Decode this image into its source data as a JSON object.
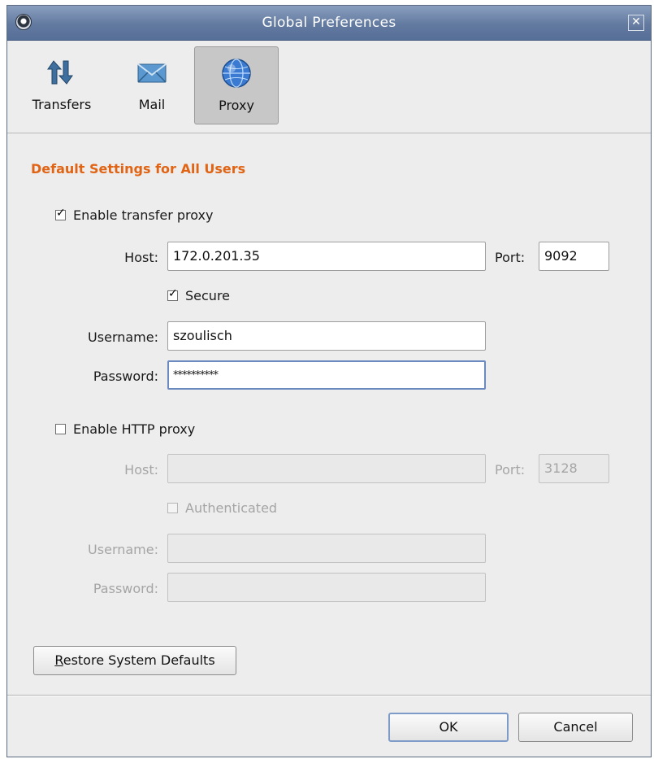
{
  "window": {
    "title": "Global Preferences",
    "close_glyph": "✕"
  },
  "toolbar": {
    "items": [
      {
        "label": "Transfers",
        "icon": "transfers-icon"
      },
      {
        "label": "Mail",
        "icon": "mail-icon"
      },
      {
        "label": "Proxy",
        "icon": "proxy-globe-icon",
        "selected": true
      }
    ]
  },
  "proxy": {
    "section_title": "Default Settings for All Users",
    "transfer": {
      "enable_label": "Enable transfer proxy",
      "enabled": true,
      "host_label": "Host:",
      "host_value": "172.0.201.35",
      "port_label": "Port:",
      "port_value": "9092",
      "secure_label": "Secure",
      "secure": true,
      "username_label": "Username:",
      "username_value": "szoulisch",
      "password_label": "Password:",
      "password_value": "**********"
    },
    "http": {
      "enable_label": "Enable HTTP proxy",
      "enabled": false,
      "host_label": "Host:",
      "host_value": "",
      "port_label": "Port:",
      "port_value": "3128",
      "authenticated_label": "Authenticated",
      "authenticated": false,
      "username_label": "Username:",
      "username_value": "",
      "password_label": "Password:",
      "password_value": ""
    }
  },
  "buttons": {
    "restore_mnemonic": "R",
    "restore_rest": "estore System Defaults",
    "ok": "OK",
    "cancel": "Cancel"
  },
  "colors": {
    "section_title": "#e06414",
    "titlebar": "#637aa0",
    "focus_border": "#6a8ac0"
  }
}
